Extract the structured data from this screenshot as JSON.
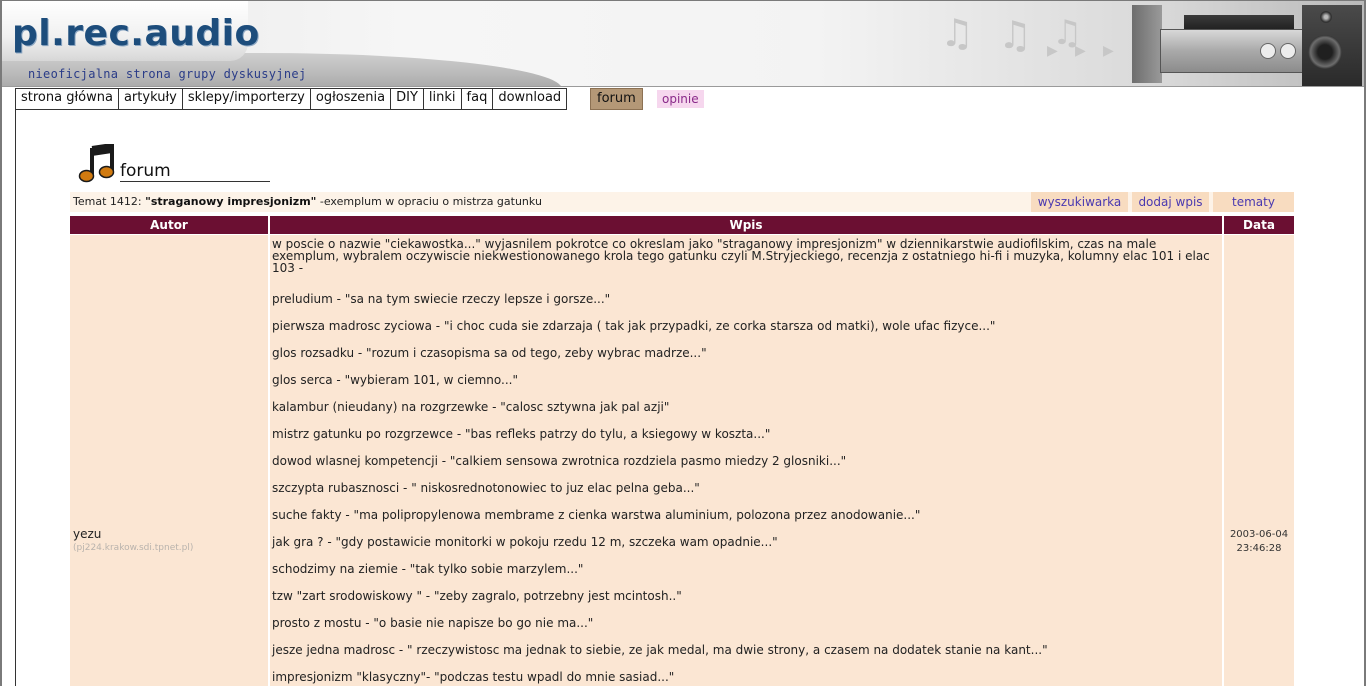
{
  "site": {
    "logo": "pl.rec.audio",
    "tagline": "nieoficjalna strona grupy dyskusyjnej"
  },
  "nav": {
    "items": [
      "strona główna",
      "artykuły",
      "sklepy/importerzy",
      "ogłoszenia",
      "DIY",
      "linki",
      "faq",
      "download"
    ],
    "forum": "forum",
    "opinie": "opinie"
  },
  "forum": {
    "title": "forum"
  },
  "topic": {
    "prefix": "Temat 1412:",
    "title": "\"straganowy impresjonizm\"",
    "suffix": "-exemplum w opraciu o mistrza gatunku",
    "buttons": {
      "search": "wyszukiwarka",
      "add": "dodaj wpis",
      "topics": "tematy"
    }
  },
  "table": {
    "headers": {
      "author": "Autor",
      "post": "Wpis",
      "date": "Data"
    }
  },
  "post": {
    "author": "yezu",
    "host": "(pj224.krakow.sdi.tpnet.pl)",
    "date": "2003-06-04",
    "time": "23:46:28",
    "intro": "w poscie o nazwie \"ciekawostka...\" wyjasnilem pokrotce co okreslam jako \"straganowy impresjonizm\" w dziennikarstwie audiofilskim, czas na male exemplum, wybralem oczywiscie niekwestionowanego krola tego gatunku czyli M.Stryjeckiego, recenzja z ostatniego hi-fi i muzyka, kolumny elac 101 i elac 103 -",
    "lines": [
      "preludium - \"sa na tym swiecie rzeczy lepsze i gorsze...\"",
      "pierwsza madrosc zyciowa - \"i choc cuda sie zdarzaja ( tak jak przypadki, ze corka starsza od matki), wole ufac fizyce...\"",
      "glos rozsadku - \"rozum i czasopisma sa od tego, zeby wybrac madrze...\"",
      "glos serca - \"wybieram 101, w ciemno...\"",
      "kalambur (nieudany) na rozgrzewke - \"calosc sztywna jak pal azji\"",
      "mistrz gatunku po rozgrzewce - \"bas refleks patrzy do tylu, a ksiegowy w koszta...\"",
      "dowod wlasnej kompetencji - \"calkiem sensowa zwrotnica rozdziela pasmo miedzy 2 glosniki...\"",
      "szczypta rubasznosci - \" niskosrednotonowiec to juz elac pelna geba...\"",
      "suche fakty - \"ma polipropylenowa membrame z cienka warstwa aluminium, polozona przez anodowanie...\"",
      "jak gra ? - \"gdy postawicie monitorki w pokoju rzedu 12 m, szczeka wam opadnie...\"",
      "schodzimy na ziemie - \"tak tylko sobie marzylem...\"",
      "tzw \"zart srodowiskowy \" - \"zeby zagralo, potrzebny jest mcintosh..\"",
      "prosto z mostu - \"o basie nie napisze bo go nie ma...\"",
      "jesze jedna madrosc - \" rzeczywistosc ma jednak to siebie, ze jak medal, ma dwie strony, a czasem na dodatek stanie na kant...\"",
      "impresjonizm \"klasyczny\"- \"podczas testu wpadl do mnie sasiad...\""
    ]
  },
  "colors": {
    "header_bg": "#6b0f32",
    "row_bg": "#fbe6d3",
    "topic_bg": "#fdf3e8",
    "button_bg": "#f8dcc0",
    "button_text": "#4a39b0",
    "forum_tab": "#b49877",
    "opinie_tab": "#f6d7ee",
    "logo": "#1d4d7c"
  }
}
